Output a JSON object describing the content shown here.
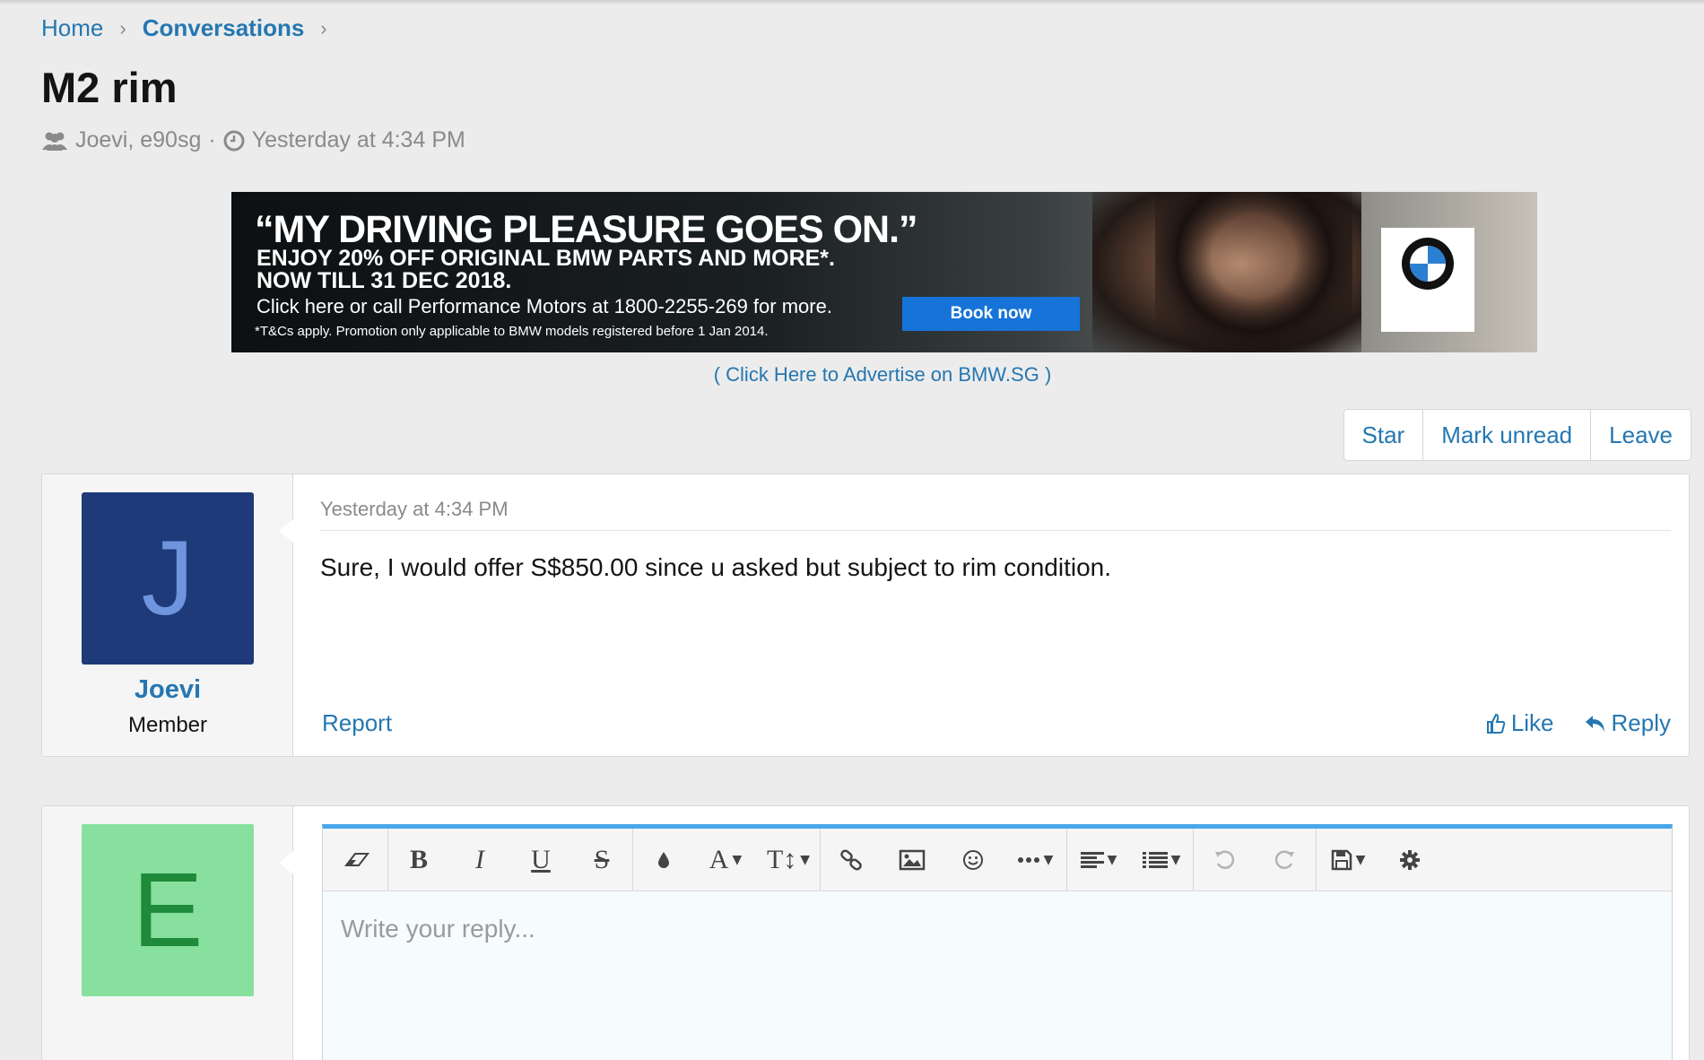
{
  "breadcrumb": {
    "home": "Home",
    "conversations": "Conversations"
  },
  "title": "M2 rim",
  "meta": {
    "participants": "Joevi, e90sg",
    "time": "Yesterday at 4:34 PM"
  },
  "banner": {
    "headline": "“MY DRIVING PLEASURE GOES ON.”",
    "line1": "ENJOY 20% OFF ORIGINAL BMW PARTS AND MORE*.",
    "line2": "NOW TILL 31 DEC 2018.",
    "call": "Click here or call Performance Motors at 1800-2255-269 for more.",
    "fine": "*T&Cs apply. Promotion only applicable to BMW models registered before 1 Jan 2014.",
    "button": "Book now"
  },
  "advertise_link": "( Click Here to Advertise on BMW.SG )",
  "actions": {
    "star": "Star",
    "mark_unread": "Mark unread",
    "leave": "Leave"
  },
  "message": {
    "avatar_letter": "J",
    "username": "Joevi",
    "user_title": "Member",
    "date": "Yesterday at 4:34 PM",
    "body": "Sure, I would offer S$850.00 since u asked but subject to rim condition.",
    "report": "Report",
    "like": "Like",
    "reply": "Reply"
  },
  "reply_box": {
    "avatar_letter": "E",
    "placeholder": "Write your reply..."
  },
  "colors": {
    "link": "#2577b1",
    "avatar_j_bg": "#1e3a78",
    "avatar_e_bg": "#88e09e",
    "editor_accent": "#47a7eb"
  },
  "toolbar_icons": [
    "eraser-icon",
    "bold-icon",
    "italic-icon",
    "underline-icon",
    "strikethrough-icon",
    "color-icon",
    "font-family-icon",
    "font-size-icon",
    "link-icon",
    "image-icon",
    "smiley-icon",
    "more-icon",
    "align-icon",
    "list-icon",
    "undo-icon",
    "redo-icon",
    "drafts-icon",
    "settings-icon"
  ]
}
